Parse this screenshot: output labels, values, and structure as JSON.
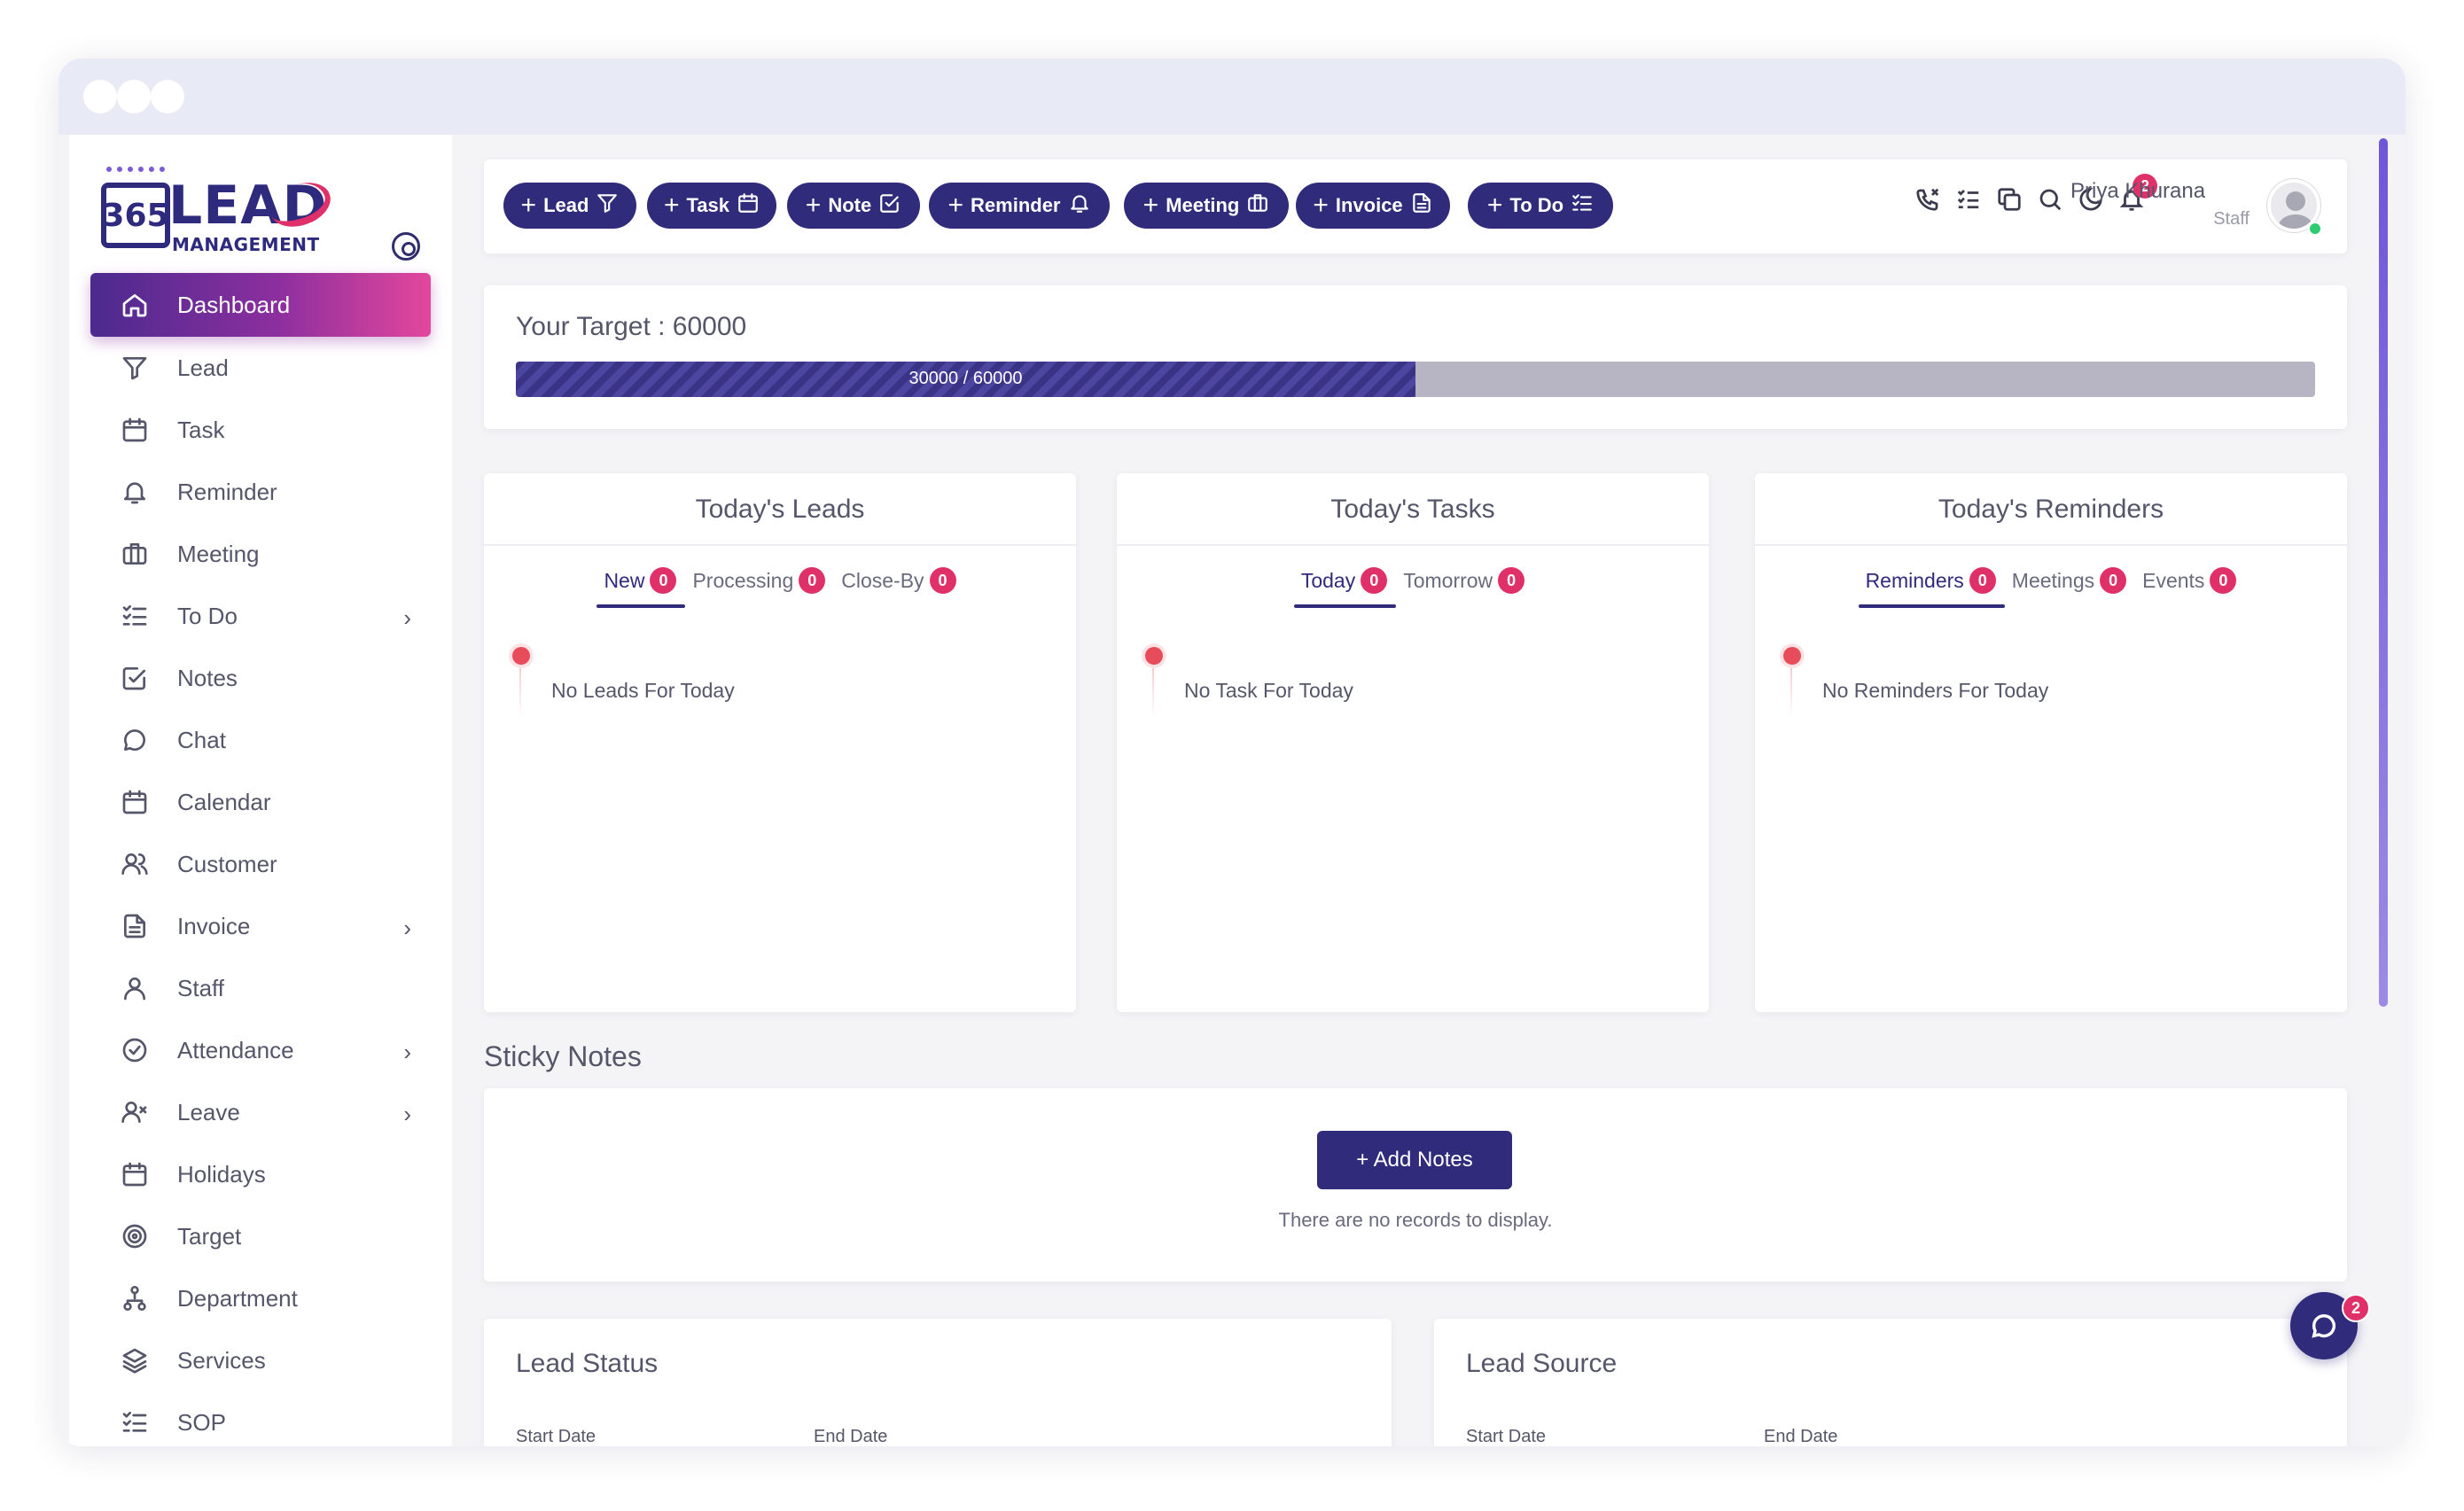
{
  "brand": {
    "logo_badge": "365",
    "logo_word": "LEAD",
    "logo_sub": "MANAGEMENT"
  },
  "sidebar": {
    "items": [
      {
        "label": "Dashboard",
        "icon": "home-icon",
        "active": true,
        "chevron": false
      },
      {
        "label": "Lead",
        "icon": "filter-icon",
        "chevron": false
      },
      {
        "label": "Task",
        "icon": "calendar-icon",
        "chevron": false
      },
      {
        "label": "Reminder",
        "icon": "bell-icon",
        "chevron": false
      },
      {
        "label": "Meeting",
        "icon": "briefcase-icon",
        "chevron": false
      },
      {
        "label": "To Do",
        "icon": "checklist-icon",
        "chevron": true
      },
      {
        "label": "Notes",
        "icon": "note-check-icon",
        "chevron": false
      },
      {
        "label": "Chat",
        "icon": "chat-icon",
        "chevron": false
      },
      {
        "label": "Calendar",
        "icon": "calendar-icon",
        "chevron": false
      },
      {
        "label": "Customer",
        "icon": "users-icon",
        "chevron": false
      },
      {
        "label": "Invoice",
        "icon": "document-icon",
        "chevron": true
      },
      {
        "label": "Staff",
        "icon": "user-icon",
        "chevron": false
      },
      {
        "label": "Attendance",
        "icon": "check-circle-icon",
        "chevron": true
      },
      {
        "label": "Leave",
        "icon": "user-x-icon",
        "chevron": true
      },
      {
        "label": "Holidays",
        "icon": "calendar-icon",
        "chevron": false
      },
      {
        "label": "Target",
        "icon": "target-icon",
        "chevron": false
      },
      {
        "label": "Department",
        "icon": "hierarchy-icon",
        "chevron": false
      },
      {
        "label": "Services",
        "icon": "layers-icon",
        "chevron": false
      },
      {
        "label": "SOP",
        "icon": "list-icon",
        "chevron": false
      }
    ]
  },
  "quick_actions": [
    {
      "label": "Lead",
      "icon": "filter-icon"
    },
    {
      "label": "Task",
      "icon": "calendar-icon"
    },
    {
      "label": "Note",
      "icon": "note-check-icon"
    },
    {
      "label": "Reminder",
      "icon": "bell-icon"
    },
    {
      "label": "Meeting",
      "icon": "briefcase-icon"
    },
    {
      "label": "Invoice",
      "icon": "document-icon"
    },
    {
      "label": "To Do",
      "icon": "checklist-icon"
    }
  ],
  "header": {
    "notification_count": "2",
    "user_name": "Priya Khurana",
    "user_role": "Staff"
  },
  "target": {
    "title": "Your Target : 60000",
    "progress_label": "30000 / 60000",
    "achieved": 30000,
    "goal": 60000
  },
  "cards": {
    "leads": {
      "title": "Today's Leads",
      "tabs": [
        {
          "label": "New",
          "count": "0"
        },
        {
          "label": "Processing",
          "count": "0"
        },
        {
          "label": "Close-By",
          "count": "0"
        }
      ],
      "empty": "No Leads For Today"
    },
    "tasks": {
      "title": "Today's Tasks",
      "tabs": [
        {
          "label": "Today",
          "count": "0"
        },
        {
          "label": "Tomorrow",
          "count": "0"
        }
      ],
      "empty": "No Task For Today"
    },
    "reminders": {
      "title": "Today's Reminders",
      "tabs": [
        {
          "label": "Reminders",
          "count": "0"
        },
        {
          "label": "Meetings",
          "count": "0"
        },
        {
          "label": "Events",
          "count": "0"
        }
      ],
      "empty": "No Reminders For Today"
    }
  },
  "sticky": {
    "title": "Sticky Notes",
    "add_label": "+ Add Notes",
    "empty": "There are no records to display."
  },
  "lead_status": {
    "title": "Lead Status",
    "start_label": "Start Date",
    "end_label": "End Date"
  },
  "lead_source": {
    "title": "Lead Source",
    "start_label": "Start Date",
    "end_label": "End Date"
  },
  "chat": {
    "badge": "2"
  },
  "colors": {
    "primary": "#302b7b",
    "accent_pink": "#e0306a",
    "gradient_start": "#4b2a8e",
    "gradient_end": "#e3479c"
  }
}
